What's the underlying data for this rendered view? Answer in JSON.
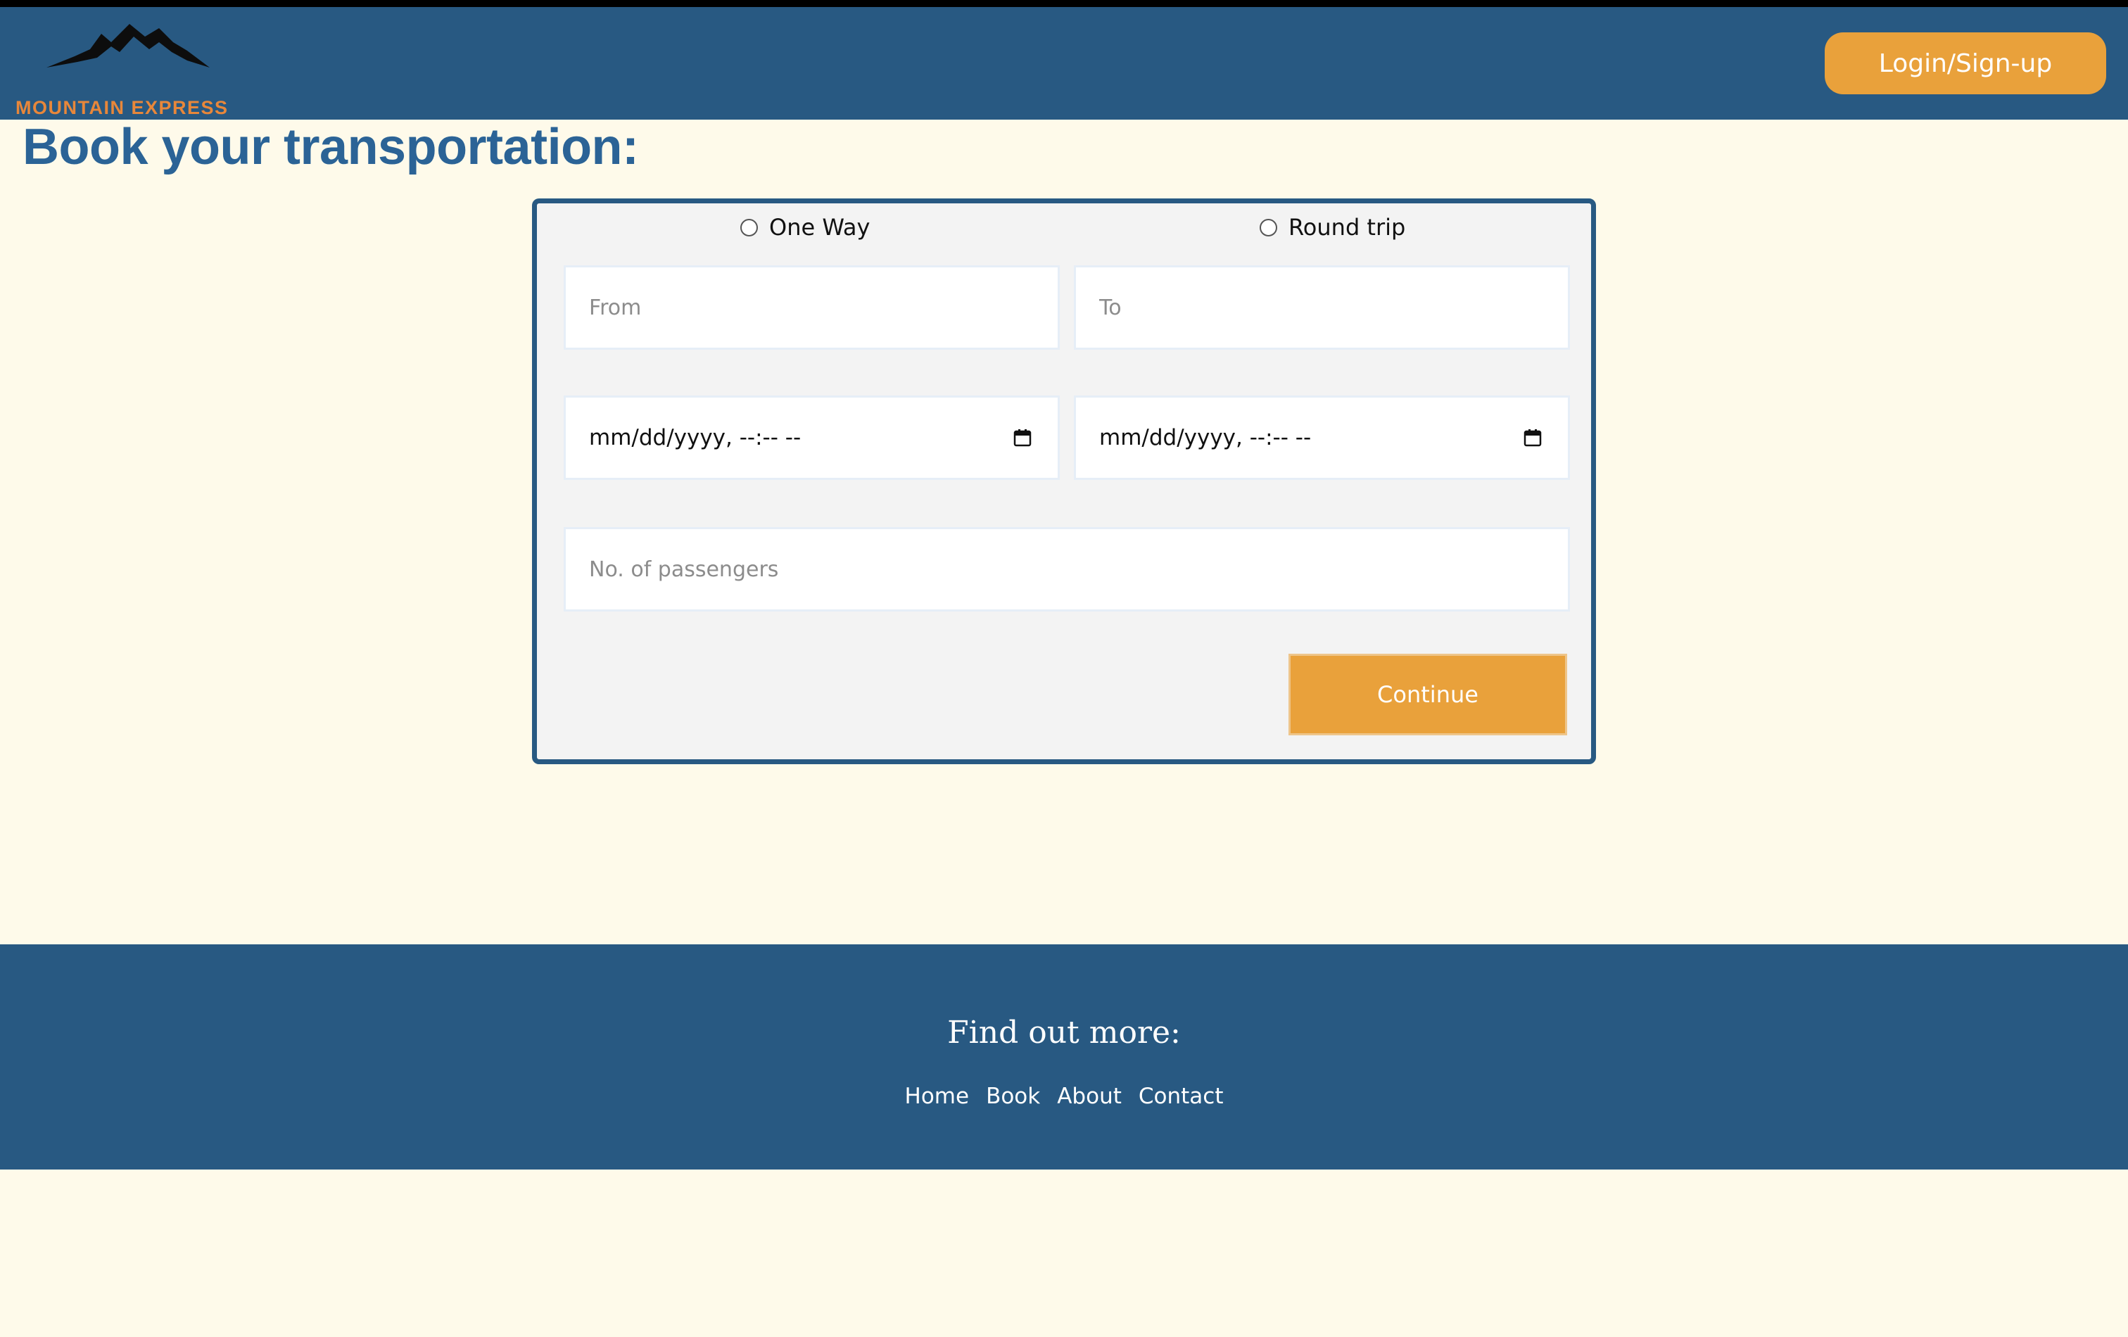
{
  "header": {
    "logo_text": "MOUNTAIN EXPRESS",
    "login_label": "Login/Sign-up"
  },
  "page": {
    "title": "Book your transportation:"
  },
  "booking_form": {
    "trip_type": {
      "one_way_label": "One Way",
      "round_trip_label": "Round trip",
      "selected": ""
    },
    "from_placeholder": "From",
    "to_placeholder": "To",
    "depart_datetime": "mm/dd/yyyy, --:-- --",
    "return_datetime": "mm/dd/yyyy, --:-- --",
    "passengers_placeholder": "No. of passengers",
    "continue_label": "Continue"
  },
  "footer": {
    "title": "Find out more:",
    "links": [
      "Home",
      "Book",
      "About",
      "Contact"
    ]
  },
  "colors": {
    "brand_blue": "#285982",
    "title_blue": "#2b6396",
    "accent_orange": "#e9a13b",
    "logo_orange": "#e8873a",
    "page_bg": "#fefaea"
  },
  "icons": {
    "logo": "mountain-logo-icon",
    "date_picker": "calendar-icon",
    "radio": "radio-unchecked-icon"
  }
}
